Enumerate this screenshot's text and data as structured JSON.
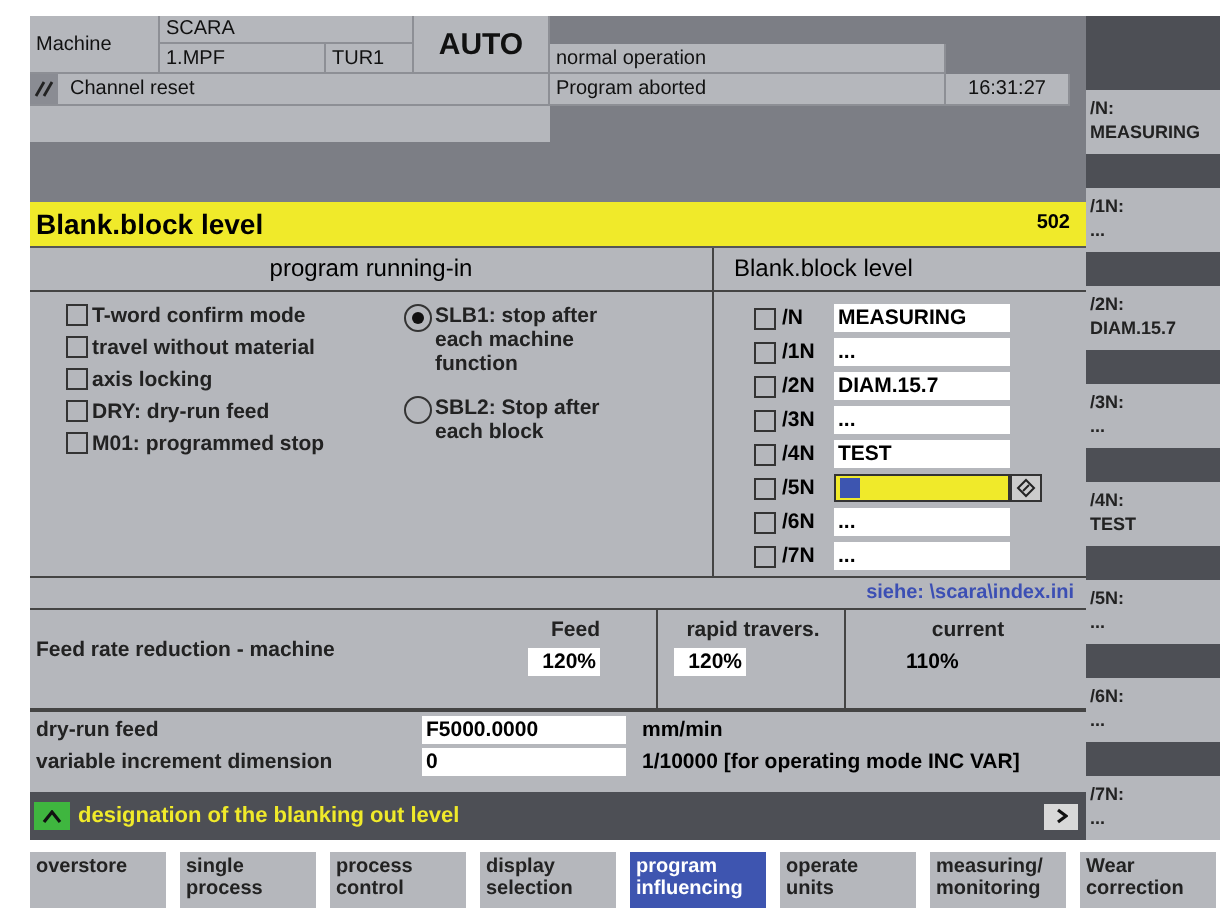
{
  "header": {
    "machine_label": "Machine",
    "program": "SCARA",
    "file": "1.MPF",
    "tool": "TUR1",
    "mode": "AUTO",
    "channel_status": "Channel reset",
    "operation": "normal operation",
    "program_status": "Program aborted",
    "time": "16:31:27"
  },
  "title": {
    "text": "Blank.block level",
    "number": "502"
  },
  "running_in": {
    "heading": "program running-in",
    "options": [
      {
        "label": "T-word confirm mode",
        "checked": false
      },
      {
        "label": "travel without material",
        "checked": false
      },
      {
        "label": "axis locking",
        "checked": false
      },
      {
        "label": "DRY: dry-run feed",
        "checked": false
      },
      {
        "label": "M01: programmed stop",
        "checked": false
      }
    ],
    "modes": [
      {
        "label": "SLB1: stop after each machine function",
        "selected": true
      },
      {
        "label": "SBL2: Stop after each block",
        "selected": false
      }
    ]
  },
  "skip_levels": {
    "heading": "Blank.block level",
    "rows": [
      {
        "level": "/N",
        "checked": false,
        "value": "MEASURING",
        "focused": false
      },
      {
        "level": "/1N",
        "checked": false,
        "value": "...",
        "focused": false
      },
      {
        "level": "/2N",
        "checked": false,
        "value": "DIAM.15.7",
        "focused": false
      },
      {
        "level": "/3N",
        "checked": false,
        "value": "...",
        "focused": false
      },
      {
        "level": "/4N",
        "checked": false,
        "value": "TEST",
        "focused": false
      },
      {
        "level": "/5N",
        "checked": false,
        "focused": true
      },
      {
        "level": "/6N",
        "checked": false,
        "value": "...",
        "focused": false
      },
      {
        "level": "/7N",
        "checked": false,
        "value": "...",
        "focused": false
      }
    ]
  },
  "link": "siehe: \\scara\\index.ini",
  "feed": {
    "label": "Feed rate reduction - machine",
    "columns": [
      {
        "heading": "Feed",
        "value": "120%",
        "editable": true
      },
      {
        "heading": "rapid travers.",
        "value": "120%",
        "editable": true
      },
      {
        "heading": "current",
        "value": "110%",
        "editable": false
      }
    ]
  },
  "settings": [
    {
      "label": "dry-run feed",
      "value": "F5000.0000",
      "unit": "mm/min"
    },
    {
      "label": "variable increment dimension",
      "value": "0",
      "unit": "1/10000 [for operating mode INC VAR]"
    }
  ],
  "hint": "designation of the blanking out level",
  "side_softkeys": [
    {
      "label": "/N:",
      "value": "MEASURING"
    },
    {
      "label": "/1N:",
      "value": "..."
    },
    {
      "label": "/2N:",
      "value": "DIAM.15.7"
    },
    {
      "label": "/3N:",
      "value": "..."
    },
    {
      "label": "/4N:",
      "value": "TEST"
    },
    {
      "label": "/5N:",
      "value": "..."
    },
    {
      "label": "/6N:",
      "value": "..."
    },
    {
      "label": "/7N:",
      "value": "..."
    }
  ],
  "bottom_softkeys": [
    {
      "label": "overstore",
      "selected": false
    },
    {
      "label": "single process",
      "selected": false
    },
    {
      "label": "process control",
      "selected": false
    },
    {
      "label": "display selection",
      "selected": false
    },
    {
      "label": "program influencing",
      "selected": true
    },
    {
      "label": "operate units",
      "selected": false
    },
    {
      "label": "measuring/ monitoring",
      "selected": false
    },
    {
      "label": "Wear correction",
      "selected": false
    }
  ]
}
